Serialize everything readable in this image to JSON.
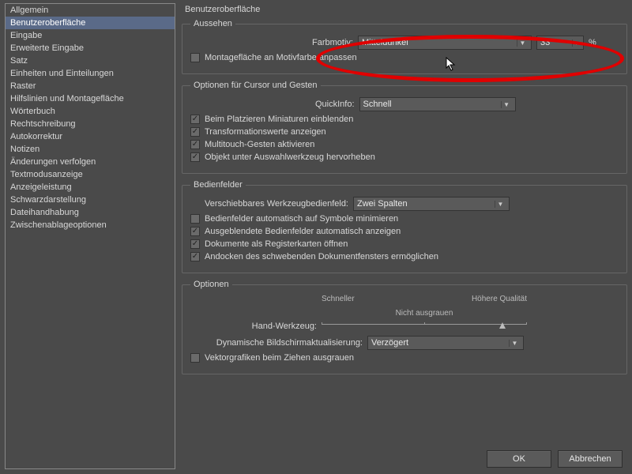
{
  "main_title": "Benutzeroberfläche",
  "sidebar": {
    "items": [
      "Allgemein",
      "Benutzeroberfläche",
      "Eingabe",
      "Erweiterte Eingabe",
      "Satz",
      "Einheiten und Einteilungen",
      "Raster",
      "Hilfslinien und Montagefläche",
      "Wörterbuch",
      "Rechtschreibung",
      "Autokorrektur",
      "Notizen",
      "Änderungen verfolgen",
      "Textmodusanzeige",
      "Anzeigeleistung",
      "Schwarzdarstellung",
      "Dateihandhabung",
      "Zwischenablageoptionen"
    ],
    "selected_index": 1
  },
  "aussehen": {
    "legend": "Aussehen",
    "farbmotiv_label": "Farbmotiv:",
    "farbmotiv_value": "Mitteldunkel",
    "brightness_value": "33",
    "percent": "%",
    "matchpasteboard_label": "Montagefläche an Motivfarbe anpassen",
    "matchpasteboard_checked": false
  },
  "cursor": {
    "legend": "Optionen für Cursor und Gesten",
    "quickinfo_label": "QuickInfo:",
    "quickinfo_value": "Schnell",
    "c1_label": "Beim Platzieren Miniaturen einblenden",
    "c2_label": "Transformationswerte anzeigen",
    "c3_label": "Multitouch-Gesten aktivieren",
    "c4_label": "Objekt unter Auswahlwerkzeug hervorheben"
  },
  "panels": {
    "legend": "Bedienfelder",
    "toolbox_label": "Verschiebbares Werkzeugbedienfeld:",
    "toolbox_value": "Zwei Spalten",
    "p1_label": "Bedienfelder automatisch auf Symbole minimieren",
    "p1_checked": false,
    "p2_label": "Ausgeblendete Bedienfelder automatisch anzeigen",
    "p2_checked": true,
    "p3_label": "Dokumente als Registerkarten öffnen",
    "p3_checked": true,
    "p4_label": "Andocken des schwebenden Dokumentfensters ermöglichen",
    "p4_checked": true
  },
  "optionen": {
    "legend": "Optionen",
    "faster": "Schneller",
    "quality": "Höhere Qualität",
    "nogrey": "Nicht ausgrauen",
    "hand_label": "Hand-Werkzeug:",
    "dyn_label": "Dynamische Bildschirmaktualisierung:",
    "dyn_value": "Verzögert",
    "vec_label": "Vektorgrafiken beim Ziehen ausgrauen",
    "vec_checked": false
  },
  "buttons": {
    "ok": "OK",
    "cancel": "Abbrechen"
  }
}
